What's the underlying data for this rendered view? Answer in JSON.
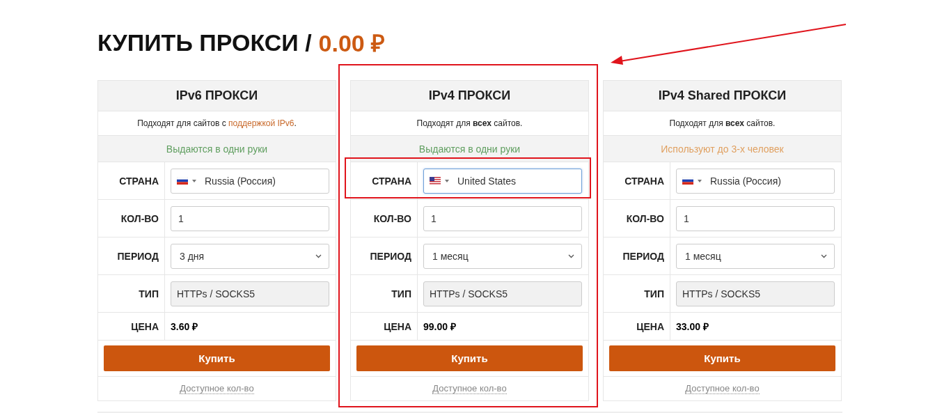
{
  "title": {
    "text": "КУПИТЬ ПРОКСИ / ",
    "total": "0.00 ₽"
  },
  "pointer_arrow": true,
  "cards": [
    {
      "title": "IPv6 ПРОКСИ",
      "highlighted": false,
      "description": {
        "text": "Подходят для сайтов с ",
        "link": "поддержкой IPv6",
        "end": "."
      },
      "note": {
        "text": "Выдаются в одни руки",
        "color": "#5f9e5f"
      },
      "rows": [
        {
          "kind": "country",
          "label": "СТРАНА",
          "value": "Russia (Россия)",
          "flag": {
            "kind": "ru"
          },
          "focused": false,
          "highlighted": false
        },
        {
          "kind": "input",
          "label": "КОЛ-ВО",
          "value": "1"
        },
        {
          "kind": "select",
          "label": "ПЕРИОД",
          "value": "3 дня"
        },
        {
          "kind": "readonly",
          "label": "ТИП",
          "value": "HTTPs / SOCKS5"
        },
        {
          "kind": "price",
          "label": "ЦЕНА",
          "value": "3.60 ₽"
        }
      ],
      "button": "Купить",
      "footer_link": "Доступное кол-во"
    },
    {
      "title": "IPv4 ПРОКСИ",
      "highlighted": true,
      "description": {
        "text": "Подходят для **всех** сайтов."
      },
      "note": {
        "text": "Выдаются в одни руки",
        "color": "#5f9e5f"
      },
      "rows": [
        {
          "kind": "country",
          "label": "СТРАНА",
          "value": "United States",
          "flag": {
            "kind": "us"
          },
          "focused": true,
          "highlighted": true
        },
        {
          "kind": "input",
          "label": "КОЛ-ВО",
          "value": "1"
        },
        {
          "kind": "select",
          "label": "ПЕРИОД",
          "value": "1 месяц"
        },
        {
          "kind": "readonly",
          "label": "ТИП",
          "value": "HTTPs / SOCKS5"
        },
        {
          "kind": "price",
          "label": "ЦЕНА",
          "value": "99.00 ₽"
        }
      ],
      "button": "Купить",
      "footer_link": "Доступное кол-во"
    },
    {
      "title": "IPv4 Shared ПРОКСИ",
      "highlighted": false,
      "description": {
        "text": "Подходят для **всех** сайтов."
      },
      "note": {
        "text": "Используют до 3-х человек",
        "color": "#e0a060"
      },
      "rows": [
        {
          "kind": "country",
          "label": "СТРАНА",
          "value": "Russia (Россия)",
          "flag": {
            "kind": "ru"
          },
          "focused": false,
          "highlighted": false
        },
        {
          "kind": "input",
          "label": "КОЛ-ВО",
          "value": "1"
        },
        {
          "kind": "select",
          "label": "ПЕРИОД",
          "value": "1 месяц"
        },
        {
          "kind": "readonly",
          "label": "ТИП",
          "value": "HTTPs / SOCKS5"
        },
        {
          "kind": "price",
          "label": "ЦЕНА",
          "value": "33.00 ₽"
        }
      ],
      "button": "Купить",
      "footer_link": "Доступное кол-во"
    }
  ]
}
